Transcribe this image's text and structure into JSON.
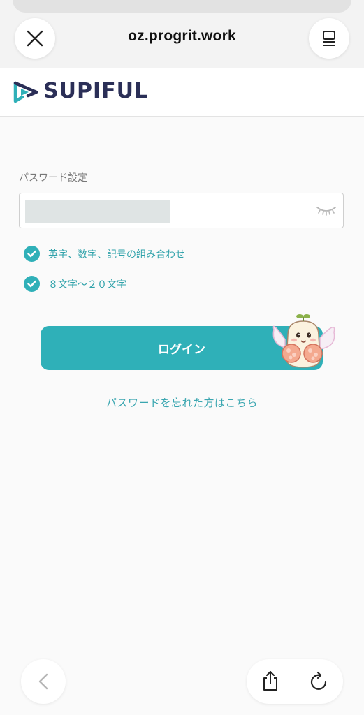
{
  "browser": {
    "url": "oz.progrit.work",
    "close_icon": "close-icon",
    "menu_icon": "page-menu-icon",
    "back_icon": "chevron-left-icon",
    "share_icon": "share-icon",
    "reload_icon": "reload-icon"
  },
  "header": {
    "logo_text": "SUPIFUL",
    "logo_icon": "play-logo-icon",
    "brand_color": "#2b2f57",
    "accent_color": "#2fb0b8"
  },
  "form": {
    "password_label": "パスワード設定",
    "password_value": "",
    "eye_icon": "eye-closed-icon",
    "requirements": [
      {
        "text": "英字、数字、記号の組み合わせ",
        "met": true
      },
      {
        "text": "８文字〜２０文字",
        "met": true
      }
    ],
    "login_label": "ログイン",
    "forgot_link": "パスワードを忘れた方はこちら"
  },
  "mascot": {
    "icon": "mascot-fairy-icon"
  }
}
